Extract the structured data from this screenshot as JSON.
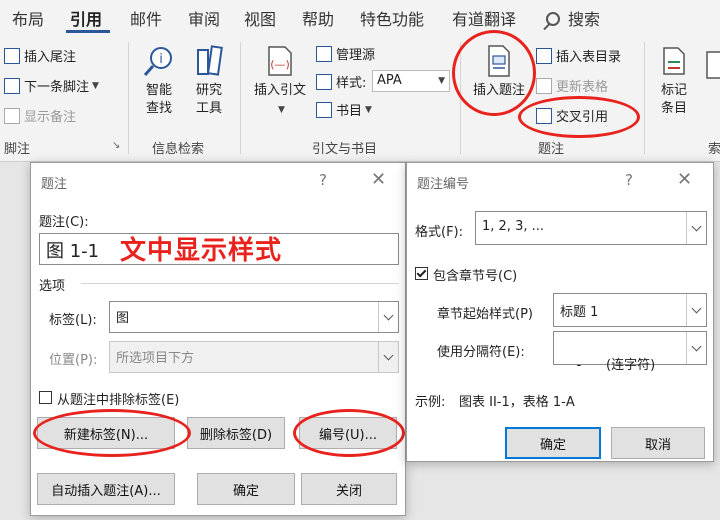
{
  "ribbon": {
    "tabs": [
      "布局",
      "引用",
      "邮件",
      "审阅",
      "视图",
      "帮助",
      "特色功能",
      "有道翻译"
    ],
    "search_label": "搜索",
    "footnotes": {
      "insert_endnote": "插入尾注",
      "next_footnote": "下一条脚注",
      "show_notes": "显示备注",
      "group_label": "脚注"
    },
    "research": {
      "smart_lookup_1": "智能",
      "smart_lookup_2": "查找",
      "research_1": "研究",
      "research_2": "工具",
      "group_label": "信息检索"
    },
    "citations": {
      "insert_citation_1": "插入引文",
      "manage_sources": "管理源",
      "style_label": "样式:",
      "style_value": "APA",
      "bibliography": "书目",
      "group_label": "引文与书目"
    },
    "captions": {
      "insert_caption": "插入题注",
      "insert_table_of_figures": "插入表目录",
      "update_table": "更新表格",
      "cross_reference": "交叉引用",
      "group_label": "题注"
    },
    "index": {
      "mark_entry_1": "标记",
      "mark_entry_2": "条目",
      "partial": "索"
    }
  },
  "caption_dialog": {
    "title": "题注",
    "help": "?",
    "caption_label": "题注(C):",
    "caption_value": "图 1-1",
    "options_label": "选项",
    "label_label": "标签(L):",
    "label_value": "图",
    "position_label": "位置(P):",
    "position_value": "所选项目下方",
    "exclude_label": "从题注中排除标签(E)",
    "new_label_btn": "新建标签(N)...",
    "delete_label_btn": "删除标签(D)",
    "numbering_btn": "编号(U)...",
    "autocaption_btn": "自动插入题注(A)...",
    "ok_btn": "确定",
    "close_btn": "关闭"
  },
  "annotation_text": "文中显示样式",
  "numbering_dialog": {
    "title": "题注编号",
    "help": "?",
    "format_label": "格式(F):",
    "format_value": "1, 2, 3, ...",
    "include_chapter_label": "包含章节号(C)",
    "chapter_style_label": "章节起始样式(P)",
    "chapter_style_value": "标题 1",
    "separator_label": "使用分隔符(E):",
    "separator_value": "-      (连字符)",
    "example_label": "示例:",
    "example_value": "图表 II-1，表格 1-A",
    "ok_btn": "确定",
    "cancel_btn": "取消"
  },
  "colors": {
    "accent": "#2b579a",
    "highlight": "#e8231e",
    "default_button": "#0078d7"
  }
}
